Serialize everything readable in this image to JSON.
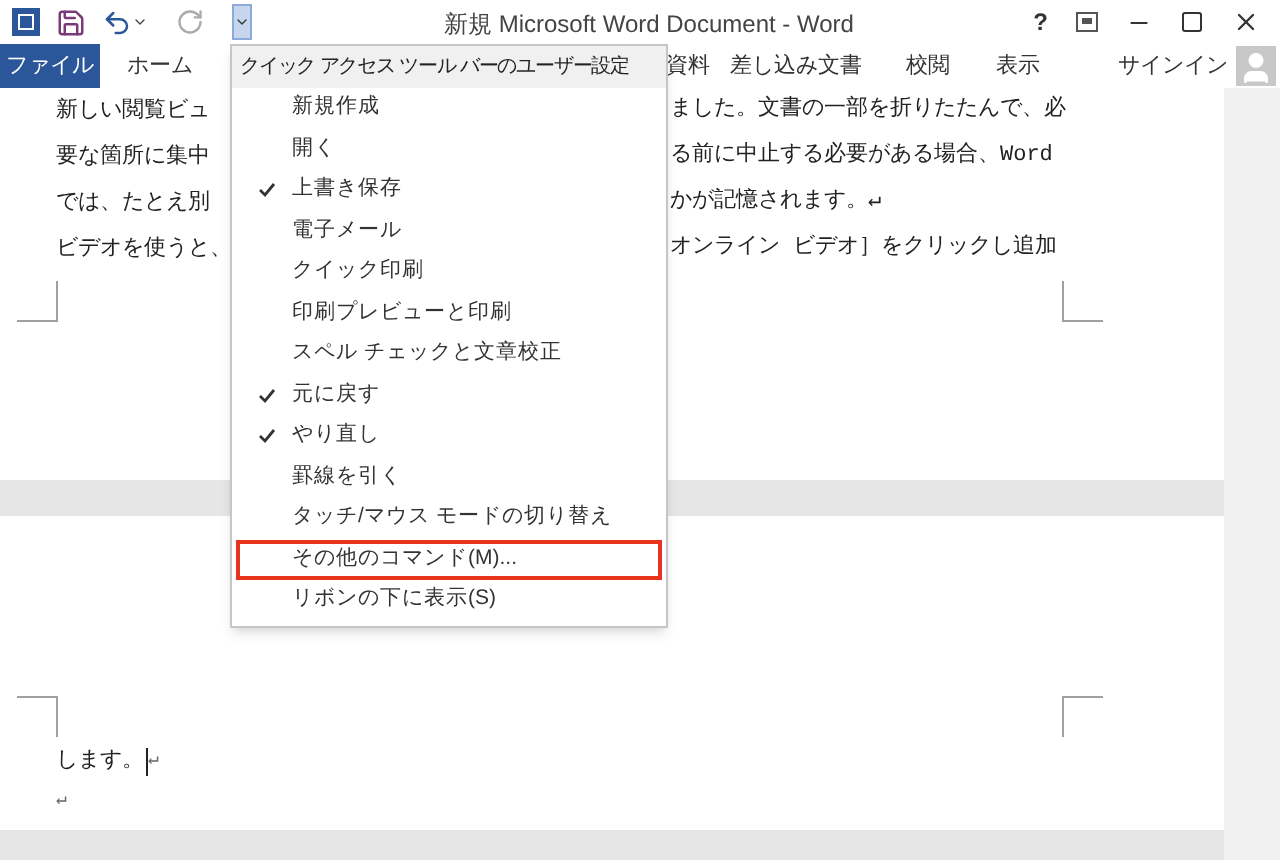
{
  "title_bar": {
    "title": "新規 Microsoft Word Document - Word",
    "help": "?"
  },
  "ribbon": {
    "tabs": [
      {
        "label": "ファイル",
        "kind": "file"
      },
      {
        "label": "ホーム",
        "kind": "tab"
      },
      {
        "label": "資料",
        "kind": "tab"
      },
      {
        "label": "差し込み文書",
        "kind": "tab"
      },
      {
        "label": "校閲",
        "kind": "tab"
      },
      {
        "label": "表示",
        "kind": "tab"
      }
    ],
    "sign_in": "サインイン"
  },
  "menu": {
    "header": "クイック アクセス ツール バーのユーザー設定",
    "items": [
      {
        "label": "新規作成",
        "checked": false,
        "highlighted": false
      },
      {
        "label": "開く",
        "checked": false,
        "highlighted": false
      },
      {
        "label": "上書き保存",
        "checked": true,
        "highlighted": false
      },
      {
        "label": "電子メール",
        "checked": false,
        "highlighted": false
      },
      {
        "label": "クイック印刷",
        "checked": false,
        "highlighted": false
      },
      {
        "label": "印刷プレビューと印刷",
        "checked": false,
        "highlighted": false
      },
      {
        "label": "スペル チェックと文章校正",
        "checked": false,
        "highlighted": false
      },
      {
        "label": "元に戻す",
        "checked": true,
        "highlighted": false
      },
      {
        "label": "やり直し",
        "checked": true,
        "highlighted": false
      },
      {
        "label": "罫線を引く",
        "checked": false,
        "highlighted": false
      },
      {
        "label": "タッチ/マウス モードの切り替え",
        "checked": false,
        "highlighted": false
      },
      {
        "label": "その他のコマンド(M)...",
        "checked": false,
        "highlighted": true
      },
      {
        "label": "リボンの下に表示(S)",
        "checked": false,
        "highlighted": false
      }
    ]
  },
  "document": {
    "page_1_lines": [
      {
        "left": "新しい閲覧ビュ",
        "right": "ました。文書の一部を折りたたんで、必"
      },
      {
        "left": "要な箇所に集中",
        "right": "る前に中止する必要がある場合、Word"
      },
      {
        "left": "では、たとえ別",
        "right": "かが記憶されます。↵"
      },
      {
        "left": "ビデオを使うと、",
        "right": "オンライン ビデオ］をクリックし追加"
      }
    ],
    "page_2_lines": [
      {
        "text": "します。",
        "cursor": true,
        "mark": "↵"
      },
      {
        "mark": "↵",
        "cursor": false
      }
    ]
  }
}
